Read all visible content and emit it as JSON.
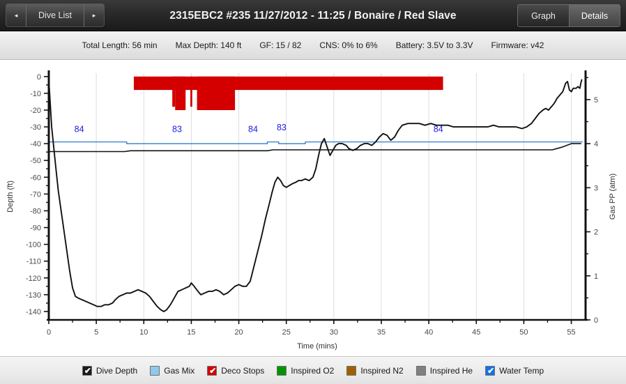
{
  "titlebar": {
    "prev_label": "◂",
    "dive_list_label": "Dive List",
    "next_label": "▸",
    "dive_title": "2315EBC2 #235 11/27/2012 - 11:25  / Bonaire / Red Slave",
    "tabs": [
      {
        "label": "Graph",
        "active": false
      },
      {
        "label": "Details",
        "active": true
      }
    ]
  },
  "infobar": {
    "items": [
      "Total Length: 56 min",
      "Max Depth: 140 ft",
      "GF: 15 / 82",
      "CNS: 0% to 6%",
      "Battery: 3.5V to 3.3V",
      "Firmware: v42"
    ]
  },
  "legend": {
    "items": [
      {
        "label": "Dive Depth",
        "color": "#1a1a1a",
        "checked": true
      },
      {
        "label": "Gas Mix",
        "color": "#8fcaea",
        "checked": false
      },
      {
        "label": "Deco Stops",
        "color": "#d40000",
        "checked": true
      },
      {
        "label": "Inspired O2",
        "color": "#009500",
        "checked": false
      },
      {
        "label": "Inspired N2",
        "color": "#a06000",
        "checked": false
      },
      {
        "label": "Inspired He",
        "color": "#808080",
        "checked": false
      },
      {
        "label": "Water Temp",
        "color": "#1473e6",
        "checked": true
      }
    ]
  },
  "chart_data": {
    "type": "line",
    "title": "",
    "xlabel": "Time (mins)",
    "ylabel": "Depth (ft)",
    "y2label": "Gas PP (atm)",
    "xlim": [
      0,
      56.5
    ],
    "ylim": [
      -145,
      2
    ],
    "y2lim": [
      0,
      5.6
    ],
    "xticks": [
      0,
      5,
      10,
      15,
      20,
      25,
      30,
      35,
      40,
      45,
      50,
      55
    ],
    "yticks": [
      0,
      -10,
      -20,
      -30,
      -40,
      -50,
      -60,
      -70,
      -80,
      -90,
      -100,
      -110,
      -120,
      -130,
      -140
    ],
    "y2ticks": [
      0,
      1,
      2,
      3,
      4,
      5
    ],
    "y2_minor_step": 0.5,
    "grid": "vertical-only",
    "colors": {
      "depth": "#111111",
      "gas_mix": "#1a6fc4",
      "deco": "#d40000",
      "water_temp": "#111111",
      "gas_label": "#1a1ae0",
      "axis": "#111111",
      "grid": "#dddddd",
      "tick_text": "#4a4a4a"
    },
    "series": [
      {
        "name": "Dive Depth",
        "axis": "left",
        "units": "ft",
        "points": [
          [
            0.0,
            -2
          ],
          [
            0.3,
            -30
          ],
          [
            0.7,
            -52
          ],
          [
            1.0,
            -68
          ],
          [
            1.3,
            -80
          ],
          [
            1.6,
            -92
          ],
          [
            1.9,
            -104
          ],
          [
            2.2,
            -116
          ],
          [
            2.5,
            -126
          ],
          [
            2.8,
            -131
          ],
          [
            3.1,
            -132
          ],
          [
            3.5,
            -133
          ],
          [
            3.9,
            -134
          ],
          [
            4.3,
            -135
          ],
          [
            4.7,
            -136
          ],
          [
            5.1,
            -137
          ],
          [
            5.5,
            -137
          ],
          [
            5.9,
            -136
          ],
          [
            6.3,
            -136
          ],
          [
            6.7,
            -135
          ],
          [
            7.0,
            -133
          ],
          [
            7.4,
            -131
          ],
          [
            7.8,
            -130
          ],
          [
            8.2,
            -129
          ],
          [
            8.6,
            -129
          ],
          [
            9.0,
            -128
          ],
          [
            9.4,
            -127
          ],
          [
            9.8,
            -128
          ],
          [
            10.2,
            -129
          ],
          [
            10.6,
            -131
          ],
          [
            11.0,
            -134
          ],
          [
            11.4,
            -137
          ],
          [
            11.8,
            -139
          ],
          [
            12.1,
            -140
          ],
          [
            12.4,
            -139
          ],
          [
            12.8,
            -136
          ],
          [
            13.2,
            -132
          ],
          [
            13.6,
            -128
          ],
          [
            14.0,
            -127
          ],
          [
            14.4,
            -126
          ],
          [
            14.8,
            -125
          ],
          [
            15.0,
            -123
          ],
          [
            15.3,
            -125
          ],
          [
            15.7,
            -128
          ],
          [
            16.0,
            -130
          ],
          [
            16.4,
            -129
          ],
          [
            16.8,
            -128
          ],
          [
            17.2,
            -128
          ],
          [
            17.6,
            -127
          ],
          [
            18.0,
            -128
          ],
          [
            18.4,
            -130
          ],
          [
            18.8,
            -129
          ],
          [
            19.2,
            -127
          ],
          [
            19.6,
            -125
          ],
          [
            20.0,
            -124
          ],
          [
            20.4,
            -125
          ],
          [
            20.8,
            -125
          ],
          [
            21.2,
            -122
          ],
          [
            21.6,
            -113
          ],
          [
            22.0,
            -104
          ],
          [
            22.4,
            -95
          ],
          [
            22.8,
            -85
          ],
          [
            23.2,
            -76
          ],
          [
            23.5,
            -69
          ],
          [
            23.8,
            -63
          ],
          [
            24.1,
            -60
          ],
          [
            24.4,
            -62
          ],
          [
            24.7,
            -65
          ],
          [
            25.0,
            -66
          ],
          [
            25.3,
            -65
          ],
          [
            25.6,
            -64
          ],
          [
            26.0,
            -63
          ],
          [
            26.3,
            -62
          ],
          [
            26.6,
            -62
          ],
          [
            27.0,
            -61
          ],
          [
            27.4,
            -62
          ],
          [
            27.8,
            -60
          ],
          [
            28.1,
            -55
          ],
          [
            28.4,
            -47
          ],
          [
            28.7,
            -40
          ],
          [
            29.0,
            -37
          ],
          [
            29.3,
            -42
          ],
          [
            29.6,
            -47
          ],
          [
            29.9,
            -44
          ],
          [
            30.2,
            -41
          ],
          [
            30.5,
            -40
          ],
          [
            30.9,
            -40
          ],
          [
            31.3,
            -41
          ],
          [
            31.6,
            -43
          ],
          [
            32.0,
            -44
          ],
          [
            32.4,
            -43
          ],
          [
            32.8,
            -41
          ],
          [
            33.2,
            -40
          ],
          [
            33.6,
            -40
          ],
          [
            34.0,
            -41
          ],
          [
            34.4,
            -39
          ],
          [
            34.8,
            -36
          ],
          [
            35.2,
            -34
          ],
          [
            35.6,
            -35
          ],
          [
            36.0,
            -38
          ],
          [
            36.4,
            -36
          ],
          [
            36.8,
            -32
          ],
          [
            37.2,
            -29
          ],
          [
            37.8,
            -28
          ],
          [
            38.4,
            -28
          ],
          [
            39.0,
            -28
          ],
          [
            39.6,
            -29
          ],
          [
            40.2,
            -28
          ],
          [
            40.8,
            -29
          ],
          [
            41.4,
            -29
          ],
          [
            42.0,
            -29
          ],
          [
            42.6,
            -30
          ],
          [
            43.2,
            -30
          ],
          [
            43.8,
            -30
          ],
          [
            44.4,
            -30
          ],
          [
            45.0,
            -30
          ],
          [
            45.6,
            -30
          ],
          [
            46.2,
            -30
          ],
          [
            46.8,
            -29
          ],
          [
            47.4,
            -30
          ],
          [
            48.0,
            -30
          ],
          [
            48.6,
            -30
          ],
          [
            49.2,
            -30
          ],
          [
            49.8,
            -31
          ],
          [
            50.3,
            -30
          ],
          [
            50.8,
            -28
          ],
          [
            51.2,
            -25
          ],
          [
            51.6,
            -22
          ],
          [
            52.0,
            -20
          ],
          [
            52.3,
            -19
          ],
          [
            52.6,
            -20
          ],
          [
            52.9,
            -18
          ],
          [
            53.2,
            -16
          ],
          [
            53.5,
            -13
          ],
          [
            53.8,
            -11
          ],
          [
            54.1,
            -9
          ],
          [
            54.4,
            -4
          ],
          [
            54.6,
            -3
          ],
          [
            54.8,
            -8
          ],
          [
            55.0,
            -9
          ],
          [
            55.2,
            -7
          ],
          [
            55.5,
            -7
          ],
          [
            55.7,
            -6
          ],
          [
            55.9,
            -7
          ],
          [
            56.0,
            -4
          ],
          [
            56.1,
            -2
          ]
        ]
      },
      {
        "name": "Water Temp",
        "axis": "right",
        "points": [
          [
            0.0,
            3.82
          ],
          [
            8.0,
            3.82
          ],
          [
            8.6,
            3.84
          ],
          [
            23.0,
            3.84
          ],
          [
            23.6,
            3.86
          ],
          [
            53.0,
            3.86
          ],
          [
            54.0,
            3.92
          ],
          [
            55.0,
            4.0
          ],
          [
            56.0,
            4.0
          ]
        ]
      },
      {
        "name": "Gas Mix",
        "axis": "left",
        "step_levels": [
          {
            "from": 0.0,
            "to": 8.2,
            "depth": -39,
            "label": "84",
            "label_x": 3.2,
            "label_depth": -33
          },
          {
            "from": 8.2,
            "to": 23.0,
            "depth": -40,
            "label": "83",
            "label_x": 13.5,
            "label_depth": -33
          },
          {
            "from": 23.0,
            "to": 24.2,
            "depth": -39,
            "label": "84",
            "label_x": 21.5,
            "label_depth": -33
          },
          {
            "from": 24.2,
            "to": 27.0,
            "depth": -40,
            "label": "83",
            "label_x": 24.5,
            "label_depth": -32
          },
          {
            "from": 27.0,
            "to": 56.2,
            "depth": -39,
            "label": "84",
            "label_x": 41.0,
            "label_depth": -33
          }
        ]
      }
    ],
    "deco_stops": {
      "name": "Deco Stops",
      "baseline_depth": 0,
      "segments": [
        {
          "from": 8.95,
          "to": 41.5,
          "depth": -8
        },
        {
          "from": 13.0,
          "to": 13.3,
          "depth": -18
        },
        {
          "from": 13.3,
          "to": 14.4,
          "depth": -20
        },
        {
          "from": 14.9,
          "to": 15.1,
          "depth": -18
        },
        {
          "from": 15.6,
          "to": 17.5,
          "depth": -20
        },
        {
          "from": 17.5,
          "to": 19.6,
          "depth": -20
        }
      ]
    }
  }
}
